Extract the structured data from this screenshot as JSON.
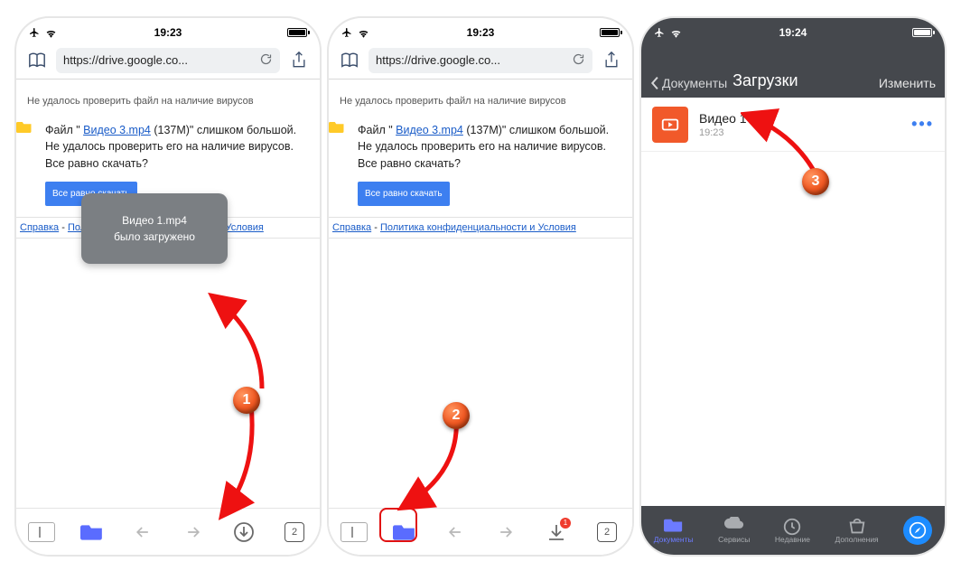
{
  "phones": {
    "p1": {
      "status": {
        "time": "19:23"
      },
      "url": "https://drive.google.co...",
      "warn_header": "Не удалось проверить файл на наличие вирусов",
      "body_prefix": "Файл \" ",
      "body_file": "Видео 3.mp4",
      "body_suffix": " (137M)\" слишком большой. Не удалось проверить его на наличие вирусов. Все равно скачать?",
      "download_btn": "Все равно скачать",
      "toast_line1": "Видео 1.mp4",
      "toast_line2": "было загружено",
      "link_help": "Справка",
      "link_sep": " - ",
      "link_policy": "Политика конфиденциальности и Условия",
      "tabs_count": "2"
    },
    "p2": {
      "status": {
        "time": "19:23"
      },
      "url": "https://drive.google.co...",
      "warn_header": "Не удалось проверить файл на наличие вирусов",
      "body_prefix": "Файл \" ",
      "body_file": "Видео 3.mp4",
      "body_suffix": " (137M)\" слишком большой. Не удалось проверить его на наличие вирусов. Все равно скачать?",
      "download_btn": "Все равно скачать",
      "link_help": "Справка",
      "link_sep": " - ",
      "link_policy": "Политика конфиденциальности и Условия",
      "tabs_count": "2",
      "dl_badge": "1"
    },
    "p3": {
      "status": {
        "time": "19:24"
      },
      "back_label": "Документы",
      "title": "Загрузки",
      "edit": "Изменить",
      "file": {
        "name": "Видео 1",
        "time": "19:23"
      },
      "tabs": [
        "Документы",
        "Сервисы",
        "Недавние",
        "Дополнения"
      ]
    }
  },
  "badges": {
    "b1": "1",
    "b2": "2",
    "b3": "3"
  }
}
